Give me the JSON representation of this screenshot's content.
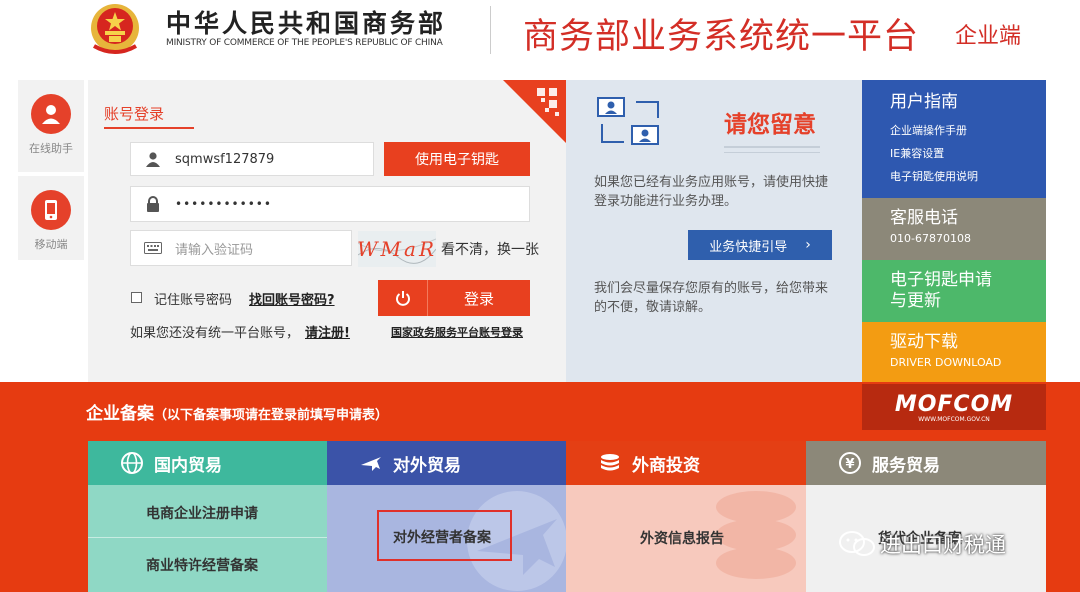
{
  "header": {
    "ministry_cn": "中华人民共和国商务部",
    "ministry_en": "MINISTRY OF COMMERCE OF THE PEOPLE'S REPUBLIC OF CHINA",
    "platform_title": "商务部业务系统统一平台",
    "platform_subtitle": "企业端"
  },
  "helpers": [
    {
      "label": "在线助手",
      "icon": "user-icon"
    },
    {
      "label": "移动端",
      "icon": "mobile-icon"
    }
  ],
  "login": {
    "tab_label": "账号登录",
    "username_value": "sqmwsf127879",
    "ekey_button": "使用电子钥匙",
    "password_value": "••••••••••••",
    "captcha_placeholder": "请输入验证码",
    "captcha_text": "WMaR",
    "captcha_refresh": "看不清，换一张",
    "remember_label": "记住账号密码",
    "forgot_link": "找回账号密码?",
    "login_button": "登录",
    "register_prompt": "如果您还没有统一平台账号，",
    "register_link": "请注册!",
    "gov_login_link": "国家政务服务平台账号登录"
  },
  "notice": {
    "title": "请您留意",
    "text1": "如果您已经有业务应用账号，请使用快捷登录功能进行业务办理。",
    "guide_button": "业务快捷引导",
    "text2": "我们会尽量保存您原有的账号，给您带来的不便，敬请谅解。"
  },
  "tiles": [
    {
      "title": "用户指南",
      "links": [
        "企业端操作手册",
        "IE兼容设置",
        "电子钥匙使用说明"
      ],
      "color": "#2e58b0"
    },
    {
      "title": "客服电话",
      "sub": "010-67870108",
      "color": "#8c8879"
    },
    {
      "title": "电子钥匙申请",
      "title2": "与更新",
      "color": "#4db86a"
    },
    {
      "title": "驱动下载",
      "sub": "DRIVER DOWNLOAD",
      "color": "#f39c12"
    }
  ],
  "band": {
    "title": "企业备案",
    "subtitle": "（以下备案事项请在登录前填写申请表）",
    "logo_text": "MOFCOM",
    "logo_url_text": "WWW.MOFCOM.GOV.CN"
  },
  "categories": [
    {
      "name": "国内贸易",
      "icon": "globe-icon",
      "items": [
        "电商企业注册申请",
        "商业特许经营备案"
      ],
      "head_color": "#3eb89d",
      "body_color": "#8fd8c5"
    },
    {
      "name": "对外贸易",
      "icon": "airplane-icon",
      "items": [
        "对外经营者备案"
      ],
      "head_color": "#3b53a8",
      "body_color": "#a9b6e0"
    },
    {
      "name": "外商投资",
      "icon": "coins-icon",
      "items": [
        "外资信息报告"
      ],
      "head_color": "#e43f14",
      "body_color": "#f7c9bd"
    },
    {
      "name": "服务贸易",
      "icon": "money-icon",
      "items": [
        "货代企业备案"
      ],
      "head_color": "#8c8879",
      "body_color": "#f0f0f0"
    }
  ],
  "watermark": "进出口财税通"
}
